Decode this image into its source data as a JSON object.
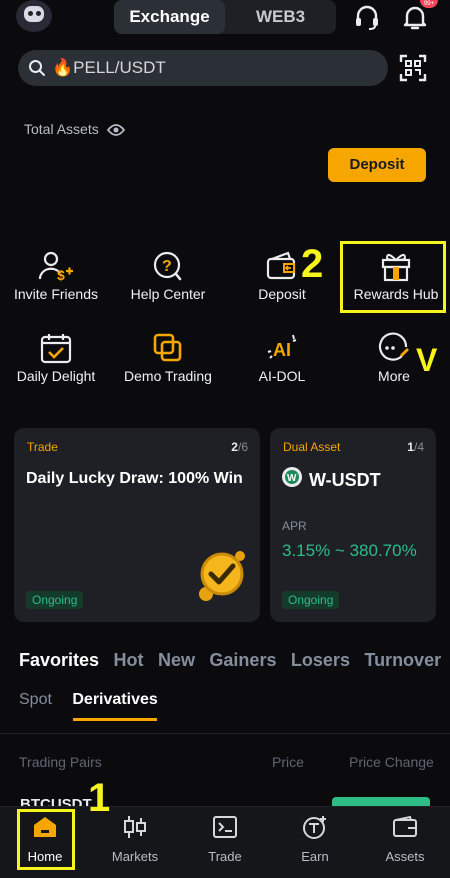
{
  "header": {
    "segments": [
      {
        "label": "Exchange",
        "active": true
      },
      {
        "label": "WEB3",
        "active": false
      }
    ],
    "notification_badge": "99+"
  },
  "search": {
    "value": "🔥PELL/USDT"
  },
  "assets": {
    "total_label": "Total Assets",
    "deposit_button": "Deposit"
  },
  "quick_actions": [
    {
      "label": "Invite Friends",
      "icon": "invite-friends-icon"
    },
    {
      "label": "Help Center",
      "icon": "help-center-icon"
    },
    {
      "label": "Deposit",
      "icon": "deposit-icon"
    },
    {
      "label": "Rewards Hub",
      "icon": "gift-icon"
    },
    {
      "label": "Daily Delight",
      "icon": "calendar-check-icon"
    },
    {
      "label": "Demo Trading",
      "icon": "demo-trading-icon"
    },
    {
      "label": "AI-DOL",
      "icon": "ai-icon"
    },
    {
      "label": "More",
      "icon": "more-icon"
    }
  ],
  "cards": [
    {
      "tag": "Trade",
      "page_current": "2",
      "page_total": "/6",
      "title": "Daily Lucky Draw: 100% Win",
      "status": "Ongoing"
    },
    {
      "tag": "Dual Asset",
      "page_current": "1",
      "page_total": "/4",
      "title": "W-USDT",
      "apr_label": "APR",
      "apr_value": "3.15% ~ 380.70%",
      "status": "Ongoing"
    }
  ],
  "market_tabs": [
    "Favorites",
    "Hot",
    "New",
    "Gainers",
    "Losers",
    "Turnover"
  ],
  "sub_tabs": [
    "Spot",
    "Derivatives"
  ],
  "table_headers": [
    "Trading Pairs",
    "Price",
    "Price Change"
  ],
  "partial_row_text": "BTCUSDT",
  "bottom_nav": [
    {
      "label": "Home",
      "icon": "home-icon",
      "active": true
    },
    {
      "label": "Markets",
      "icon": "markets-icon",
      "active": false
    },
    {
      "label": "Trade",
      "icon": "trade-icon",
      "active": false
    },
    {
      "label": "Earn",
      "icon": "earn-icon",
      "active": false
    },
    {
      "label": "Assets",
      "icon": "wallet-icon",
      "active": false
    }
  ],
  "annotations": [
    "1",
    "2",
    "V"
  ],
  "colors": {
    "accent": "#f7a600",
    "positive": "#2ebd85",
    "annotation": "#f6f31d",
    "background": "#0b0b0d",
    "card": "#1e2026"
  }
}
